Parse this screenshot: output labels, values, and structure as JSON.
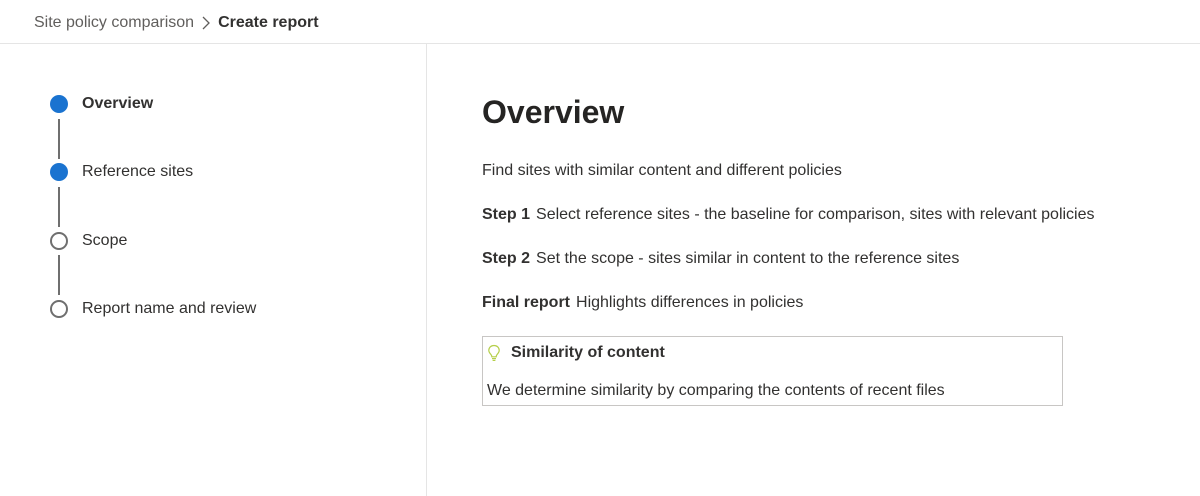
{
  "breadcrumb": {
    "parent": "Site policy comparison",
    "current": "Create report"
  },
  "steps": [
    {
      "label": "Overview",
      "status": "done"
    },
    {
      "label": "Reference sites",
      "status": "done"
    },
    {
      "label": "Scope",
      "status": "todo"
    },
    {
      "label": "Report name and review",
      "status": "todo"
    }
  ],
  "main": {
    "title": "Overview",
    "intro": "Find sites with similar content and different policies",
    "step1_label": "Step 1",
    "step1_text": "Select reference sites - the baseline for comparison, sites with relevant policies",
    "step2_label": "Step 2",
    "step2_text": "Set the scope - sites similar in content to the reference sites",
    "final_label": "Final report",
    "final_text": "Highlights differences in policies"
  },
  "callout": {
    "icon": "lightbulb-icon",
    "title": "Similarity of content",
    "body": "We determine similarity by comparing the contents of recent files"
  },
  "colors": {
    "step_done": "#1a73d0",
    "step_todo_border": "#6f6f6f",
    "bulb": "#b5cf4a"
  }
}
